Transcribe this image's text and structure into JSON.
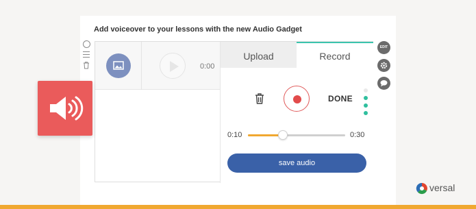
{
  "card": {
    "title": "Add voiceover to your lessons with the new Audio Gadget"
  },
  "player": {
    "time": "0:00"
  },
  "panel": {
    "tabs": [
      {
        "label": "Upload",
        "active": false
      },
      {
        "label": "Record",
        "active": true
      }
    ],
    "done_label": "DONE",
    "trim": {
      "start_label": "0:10",
      "end_label": "0:30",
      "position_fraction": 0.36
    },
    "save_label": "save audio"
  },
  "side_tools": {
    "edit_label": "EDIT"
  },
  "brand": {
    "name": "versal"
  },
  "colors": {
    "accent_teal": "#3cc4ad",
    "record_red": "#e24b4b",
    "save_blue": "#3a61a8",
    "slider_orange": "#f0a830",
    "badge_red": "#ea5b5b"
  },
  "icons": [
    "circle-icon",
    "menu-icon",
    "trash-icon",
    "image-icon",
    "play-icon",
    "record-icon",
    "settings-icon",
    "comment-icon",
    "speaker-icon",
    "versal-logo-icon"
  ]
}
